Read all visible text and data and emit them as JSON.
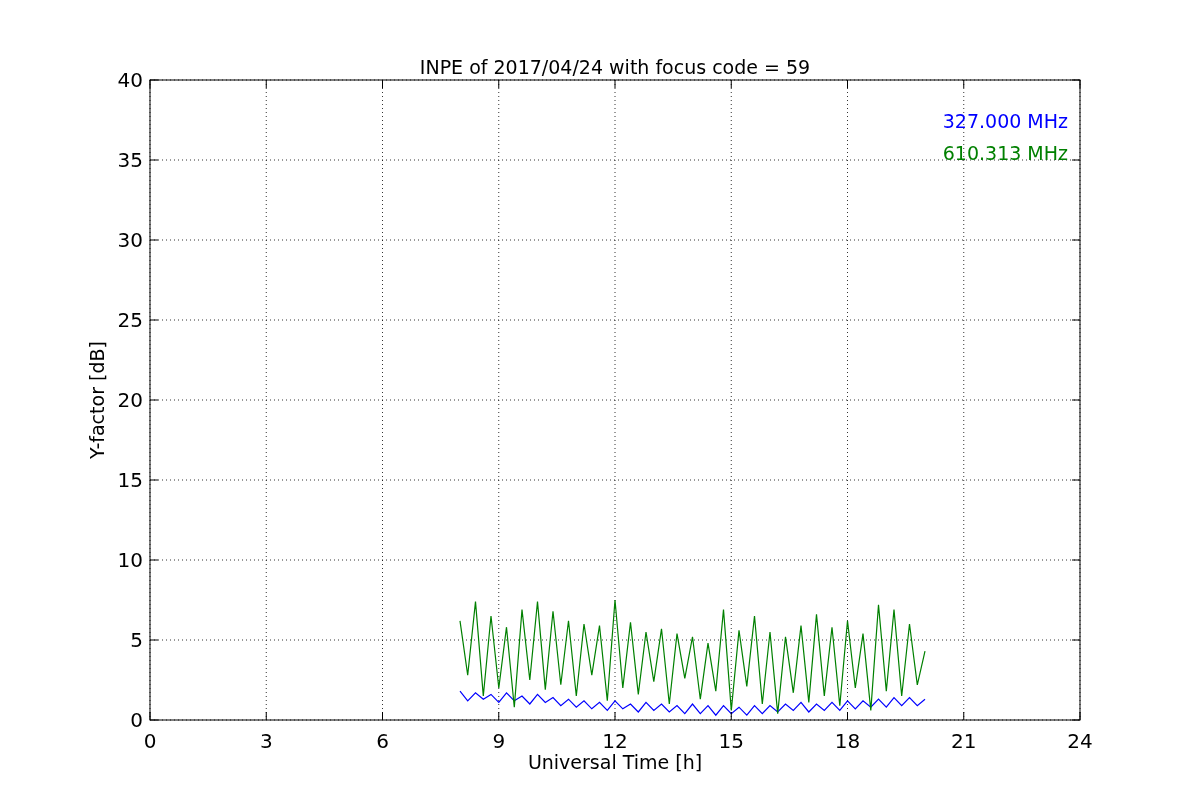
{
  "chart_data": {
    "type": "line",
    "title": "INPE of 2017/04/24 with focus code = 59",
    "xlabel": "Universal Time [h]",
    "ylabel": "Y-factor [dB]",
    "x": [
      8,
      8.2,
      8.4,
      8.6,
      8.8,
      9,
      9.2,
      9.4,
      9.6,
      9.8,
      10,
      10.2,
      10.4,
      10.6,
      10.8,
      11,
      11.2,
      11.4,
      11.6,
      11.8,
      12,
      12.2,
      12.4,
      12.6,
      12.8,
      13,
      13.2,
      13.4,
      13.6,
      13.8,
      14,
      14.2,
      14.4,
      14.6,
      14.8,
      15,
      15.2,
      15.4,
      15.6,
      15.8,
      16,
      16.2,
      16.4,
      16.6,
      16.8,
      17,
      17.2,
      17.4,
      17.6,
      17.8,
      18,
      18.2,
      18.4,
      18.6,
      18.8,
      19,
      19.2,
      19.4,
      19.6,
      19.8,
      20
    ],
    "series": [
      {
        "name": "327.000 MHz",
        "color": "#0000ff",
        "values": [
          1.8,
          1.2,
          1.7,
          1.3,
          1.6,
          1.1,
          1.7,
          1.2,
          1.5,
          1.0,
          1.6,
          1.1,
          1.4,
          0.9,
          1.3,
          0.8,
          1.2,
          0.7,
          1.1,
          0.6,
          1.2,
          0.7,
          1.0,
          0.5,
          1.1,
          0.6,
          1.0,
          0.5,
          0.9,
          0.4,
          1.0,
          0.4,
          0.9,
          0.3,
          0.9,
          0.4,
          0.8,
          0.3,
          0.9,
          0.4,
          0.9,
          0.5,
          1.0,
          0.6,
          1.1,
          0.5,
          1.0,
          0.6,
          1.1,
          0.6,
          1.2,
          0.7,
          1.2,
          0.8,
          1.3,
          0.8,
          1.4,
          0.9,
          1.4,
          0.9,
          1.3
        ]
      },
      {
        "name": "610.313 MHz",
        "color": "#008000",
        "values": [
          6.2,
          2.8,
          7.4,
          1.5,
          6.5,
          2.0,
          5.8,
          0.8,
          6.9,
          2.5,
          7.4,
          1.9,
          6.8,
          2.2,
          6.2,
          1.5,
          6.0,
          2.8,
          5.9,
          1.2,
          7.5,
          2.0,
          6.1,
          1.6,
          5.5,
          2.4,
          5.7,
          1.0,
          5.4,
          2.6,
          5.2,
          1.3,
          4.8,
          1.8,
          6.9,
          0.6,
          5.6,
          2.1,
          6.5,
          1.0,
          5.5,
          0.4,
          5.2,
          1.7,
          5.9,
          1.1,
          6.6,
          1.5,
          5.8,
          0.9,
          6.2,
          2.0,
          5.4,
          0.6,
          7.2,
          1.8,
          6.9,
          1.5,
          6.0,
          2.2,
          4.3
        ]
      }
    ],
    "xlim": [
      0,
      24
    ],
    "ylim": [
      0,
      40
    ],
    "xticks": [
      0,
      3,
      6,
      9,
      12,
      15,
      18,
      21,
      24
    ],
    "yticks": [
      0,
      5,
      10,
      15,
      20,
      25,
      30,
      35,
      40
    ],
    "grid": true
  }
}
